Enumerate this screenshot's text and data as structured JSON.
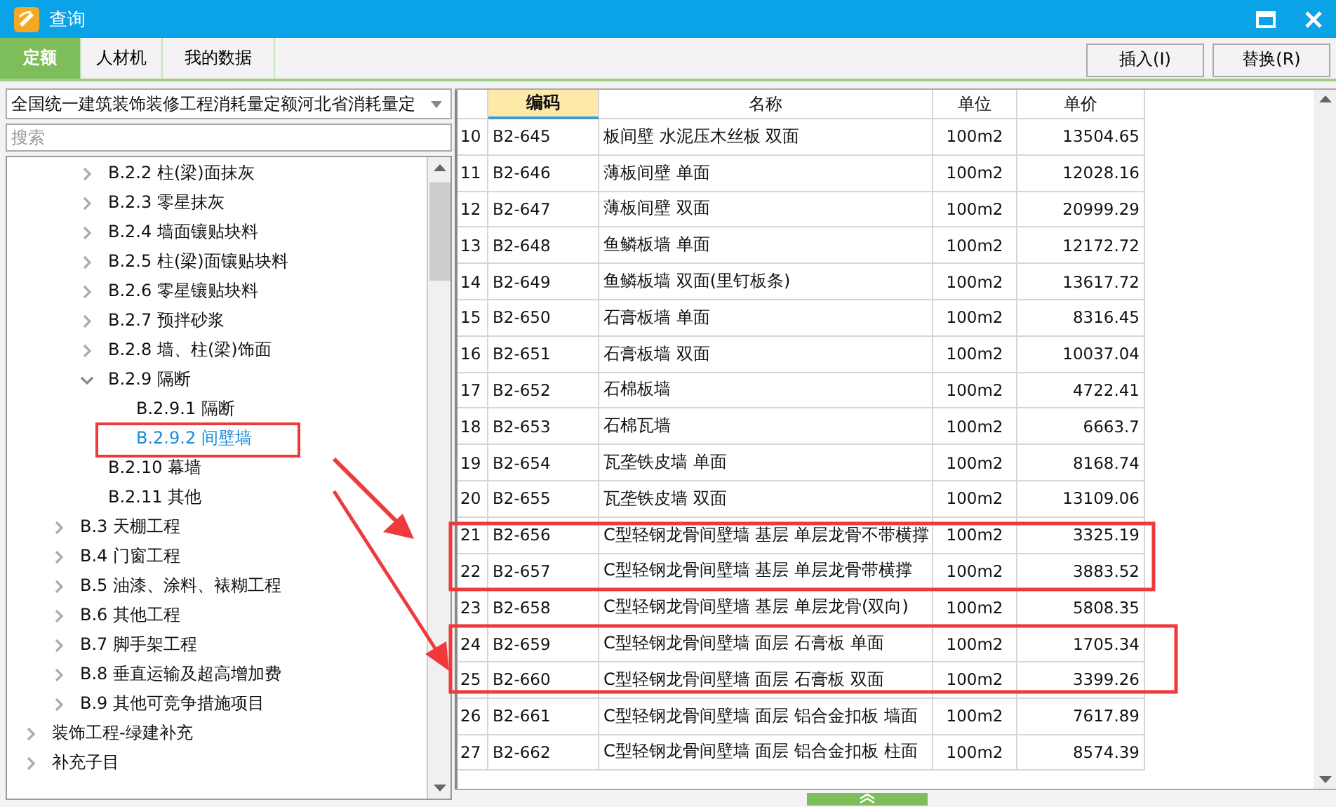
{
  "window": {
    "title": "查询"
  },
  "tabs": [
    {
      "label": "定额",
      "selected": true
    },
    {
      "label": "人材机",
      "selected": false
    },
    {
      "label": "我的数据",
      "selected": false
    }
  ],
  "buttons": [
    "插入(I)",
    "替换(R)"
  ],
  "library_select": {
    "value": "全国统一建筑装饰装修工程消耗量定额河北省消耗量定"
  },
  "search": {
    "placeholder": "搜索"
  },
  "tree": {
    "items": [
      {
        "children": [
          {
            "children": [
              {
                "label": "B.2.2 柱(梁)面抹灰",
                "expanded": false,
                "selected": false
              },
              {
                "label": "B.2.3 零星抹灰",
                "expanded": false,
                "selected": false
              },
              {
                "label": "B.2.4 墙面镶贴块料",
                "expanded": false,
                "selected": false
              },
              {
                "label": "B.2.5 柱(梁)面镶贴块料",
                "expanded": false,
                "selected": false
              },
              {
                "label": "B.2.6 零星镶贴块料",
                "expanded": false,
                "selected": false
              },
              {
                "label": "B.2.7 预拌砂浆",
                "expanded": false,
                "selected": false
              },
              {
                "label": "B.2.8 墙、柱(梁)饰面",
                "expanded": false,
                "selected": false
              },
              {
                "label": "B.2.9 隔断",
                "expanded": true,
                "selected": false,
                "children": [
                  {
                    "label": "B.2.9.1 隔断",
                    "selected": false
                  },
                  {
                    "label": "B.2.9.2 间壁墙",
                    "selected": true
                  }
                ]
              },
              {
                "label": "B.2.10 幕墙",
                "selected": false
              },
              {
                "label": "B.2.11 其他",
                "selected": false
              }
            ]
          },
          {
            "label": "B.3 天棚工程",
            "expanded": false,
            "selected": false
          },
          {
            "label": "B.4 门窗工程",
            "expanded": false,
            "selected": false
          },
          {
            "label": "B.5 油漆、涂料、裱糊工程",
            "expanded": false,
            "selected": false
          },
          {
            "label": "B.6 其他工程",
            "expanded": false,
            "selected": false
          },
          {
            "label": "B.7 脚手架工程",
            "expanded": false,
            "selected": false
          },
          {
            "label": "B.8 垂直运输及超高增加费",
            "expanded": false,
            "selected": false
          },
          {
            "label": "B.9 其他可竞争措施项目",
            "expanded": false,
            "selected": false
          }
        ]
      },
      {
        "label": "装饰工程-绿建补充",
        "expanded": false,
        "selected": false
      },
      {
        "label": "补充子目",
        "expanded": false,
        "selected": false
      }
    ]
  },
  "table": {
    "columns": [
      {
        "label": "编码",
        "selected": true
      },
      {
        "label": "名称",
        "selected": false
      },
      {
        "label": "单位",
        "selected": false
      },
      {
        "label": "单价",
        "selected": false
      }
    ],
    "rows": [
      {
        "no": "10",
        "code": "B2-645",
        "name": "板间壁 水泥压木丝板 双面",
        "unit": "100m2",
        "price": "13504.65"
      },
      {
        "no": "11",
        "code": "B2-646",
        "name": "薄板间壁 单面",
        "unit": "100m2",
        "price": "12028.16"
      },
      {
        "no": "12",
        "code": "B2-647",
        "name": "薄板间壁 双面",
        "unit": "100m2",
        "price": "20999.29"
      },
      {
        "no": "13",
        "code": "B2-648",
        "name": "鱼鳞板墙 单面",
        "unit": "100m2",
        "price": "12172.72"
      },
      {
        "no": "14",
        "code": "B2-649",
        "name": "鱼鳞板墙 双面(里钉板条)",
        "unit": "100m2",
        "price": "13617.72"
      },
      {
        "no": "15",
        "code": "B2-650",
        "name": "石膏板墙 单面",
        "unit": "100m2",
        "price": "8316.45"
      },
      {
        "no": "16",
        "code": "B2-651",
        "name": "石膏板墙 双面",
        "unit": "100m2",
        "price": "10037.04"
      },
      {
        "no": "17",
        "code": "B2-652",
        "name": "石棉板墙",
        "unit": "100m2",
        "price": "4722.41"
      },
      {
        "no": "18",
        "code": "B2-653",
        "name": "石棉瓦墙",
        "unit": "100m2",
        "price": "6663.7"
      },
      {
        "no": "19",
        "code": "B2-654",
        "name": "瓦垄铁皮墙 单面",
        "unit": "100m2",
        "price": "8168.74"
      },
      {
        "no": "20",
        "code": "B2-655",
        "name": "瓦垄铁皮墙 双面",
        "unit": "100m2",
        "price": "13109.06"
      },
      {
        "no": "21",
        "code": "B2-656",
        "name": "C型轻钢龙骨间壁墙 基层 单层龙骨不带横撑",
        "unit": "100m2",
        "price": "3325.19"
      },
      {
        "no": "22",
        "code": "B2-657",
        "name": "C型轻钢龙骨间壁墙 基层 单层龙骨带横撑",
        "unit": "100m2",
        "price": "3883.52"
      },
      {
        "no": "23",
        "code": "B2-658",
        "name": "C型轻钢龙骨间壁墙 基层 单层龙骨(双向)",
        "unit": "100m2",
        "price": "5808.35"
      },
      {
        "no": "24",
        "code": "B2-659",
        "name": "C型轻钢龙骨间壁墙 面层 石膏板 单面",
        "unit": "100m2",
        "price": "1705.34"
      },
      {
        "no": "25",
        "code": "B2-660",
        "name": "C型轻钢龙骨间壁墙 面层 石膏板 双面",
        "unit": "100m2",
        "price": "3399.26"
      },
      {
        "no": "26",
        "code": "B2-661",
        "name": "C型轻钢龙骨间壁墙 面层 铝合金扣板 墙面",
        "unit": "100m2",
        "price": "7617.89"
      },
      {
        "no": "27",
        "code": "B2-662",
        "name": "C型轻钢龙骨间壁墙 面层 铝合金扣板 柱面",
        "unit": "100m2",
        "price": "8574.39"
      }
    ]
  }
}
